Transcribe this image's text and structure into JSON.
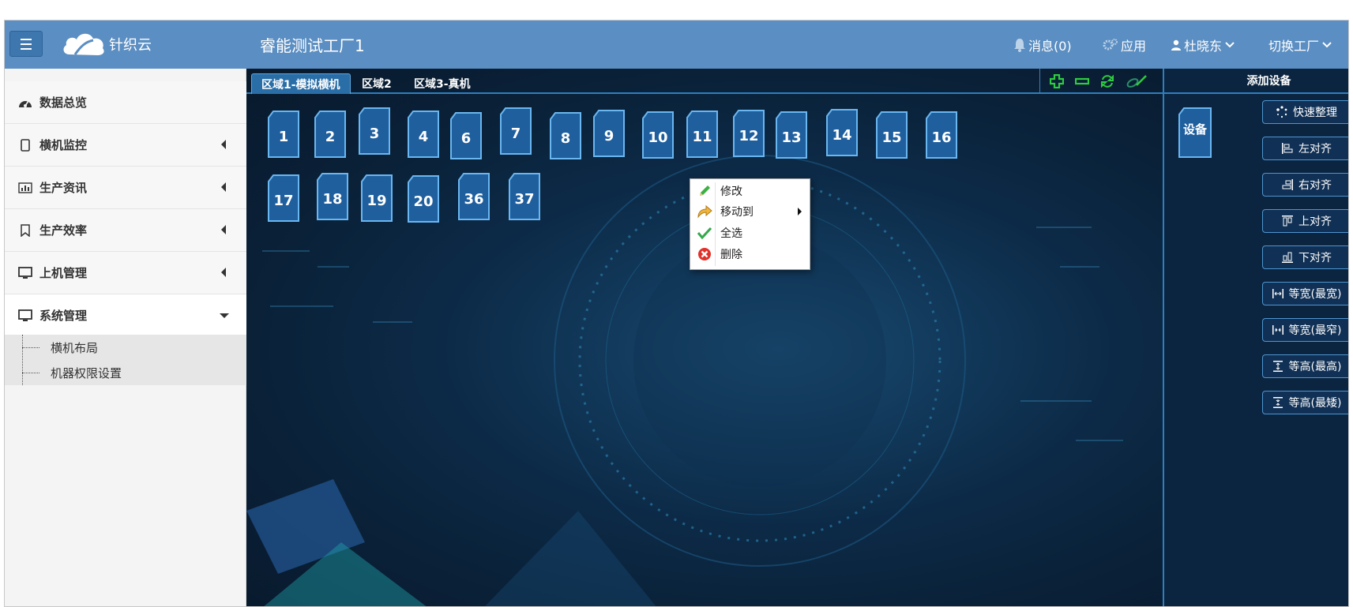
{
  "header": {
    "logo_text": "针织云",
    "factory_title": "睿能测试工厂1",
    "messages": "消息(0)",
    "apps": "应用",
    "user": "杜晓东",
    "switch_factory": "切换工厂"
  },
  "sidebar": {
    "items": [
      {
        "label": "数据总览",
        "icon": "dashboard-icon"
      },
      {
        "label": "横机监控",
        "icon": "tablet-icon"
      },
      {
        "label": "生产资讯",
        "icon": "bar-chart-icon"
      },
      {
        "label": "生产效率",
        "icon": "bookmark-icon"
      },
      {
        "label": "上机管理",
        "icon": "monitor-icon"
      },
      {
        "label": "系统管理",
        "icon": "monitor-icon"
      }
    ],
    "submenu": [
      {
        "label": "横机布局"
      },
      {
        "label": "机器权限设置"
      }
    ]
  },
  "tabs": [
    {
      "label": "区域1-模拟横机",
      "active": true
    },
    {
      "label": "区域2",
      "active": false
    },
    {
      "label": "区域3-真机",
      "active": false
    }
  ],
  "toolbar": {
    "icons": [
      "add-icon",
      "remove-icon",
      "refresh-icon",
      "link-icon"
    ],
    "colors": {
      "add": "#2ecc40",
      "remove": "#2ecc40",
      "refresh": "#2ecc40",
      "link": "#2ecc40"
    }
  },
  "machines": [
    "1",
    "2",
    "3",
    "4",
    "6",
    "7",
    "8",
    "9",
    "10",
    "11",
    "12",
    "13",
    "14",
    "15",
    "16",
    "17",
    "18",
    "19",
    "20",
    "36",
    "37"
  ],
  "context_menu": {
    "items": [
      {
        "label": "修改",
        "icon": "pencil-icon"
      },
      {
        "label": "移动到",
        "icon": "move-arrow-icon",
        "submenu": true
      },
      {
        "label": "全选",
        "icon": "checkmark-icon"
      },
      {
        "label": "删除",
        "icon": "delete-icon"
      }
    ]
  },
  "right_panel": {
    "title": "添加设备",
    "device_label": "设备",
    "buttons": [
      {
        "label": "快速整理",
        "icon": "arrange-icon"
      },
      {
        "label": "左对齐",
        "icon": "align-left-icon"
      },
      {
        "label": "右对齐",
        "icon": "align-right-icon"
      },
      {
        "label": "上对齐",
        "icon": "align-top-icon"
      },
      {
        "label": "下对齐",
        "icon": "align-bottom-icon"
      },
      {
        "label": "等宽(最宽)",
        "icon": "width-max-icon"
      },
      {
        "label": "等宽(最窄)",
        "icon": "width-min-icon"
      },
      {
        "label": "等高(最高)",
        "icon": "height-max-icon"
      },
      {
        "label": "等高(最矮)",
        "icon": "height-min-icon"
      }
    ]
  },
  "colors": {
    "topbar": "#5b8ec2",
    "canvas_bg": "#0c2a47",
    "machine_fill": "#1f5f9e",
    "machine_border": "#6ab6f0"
  }
}
